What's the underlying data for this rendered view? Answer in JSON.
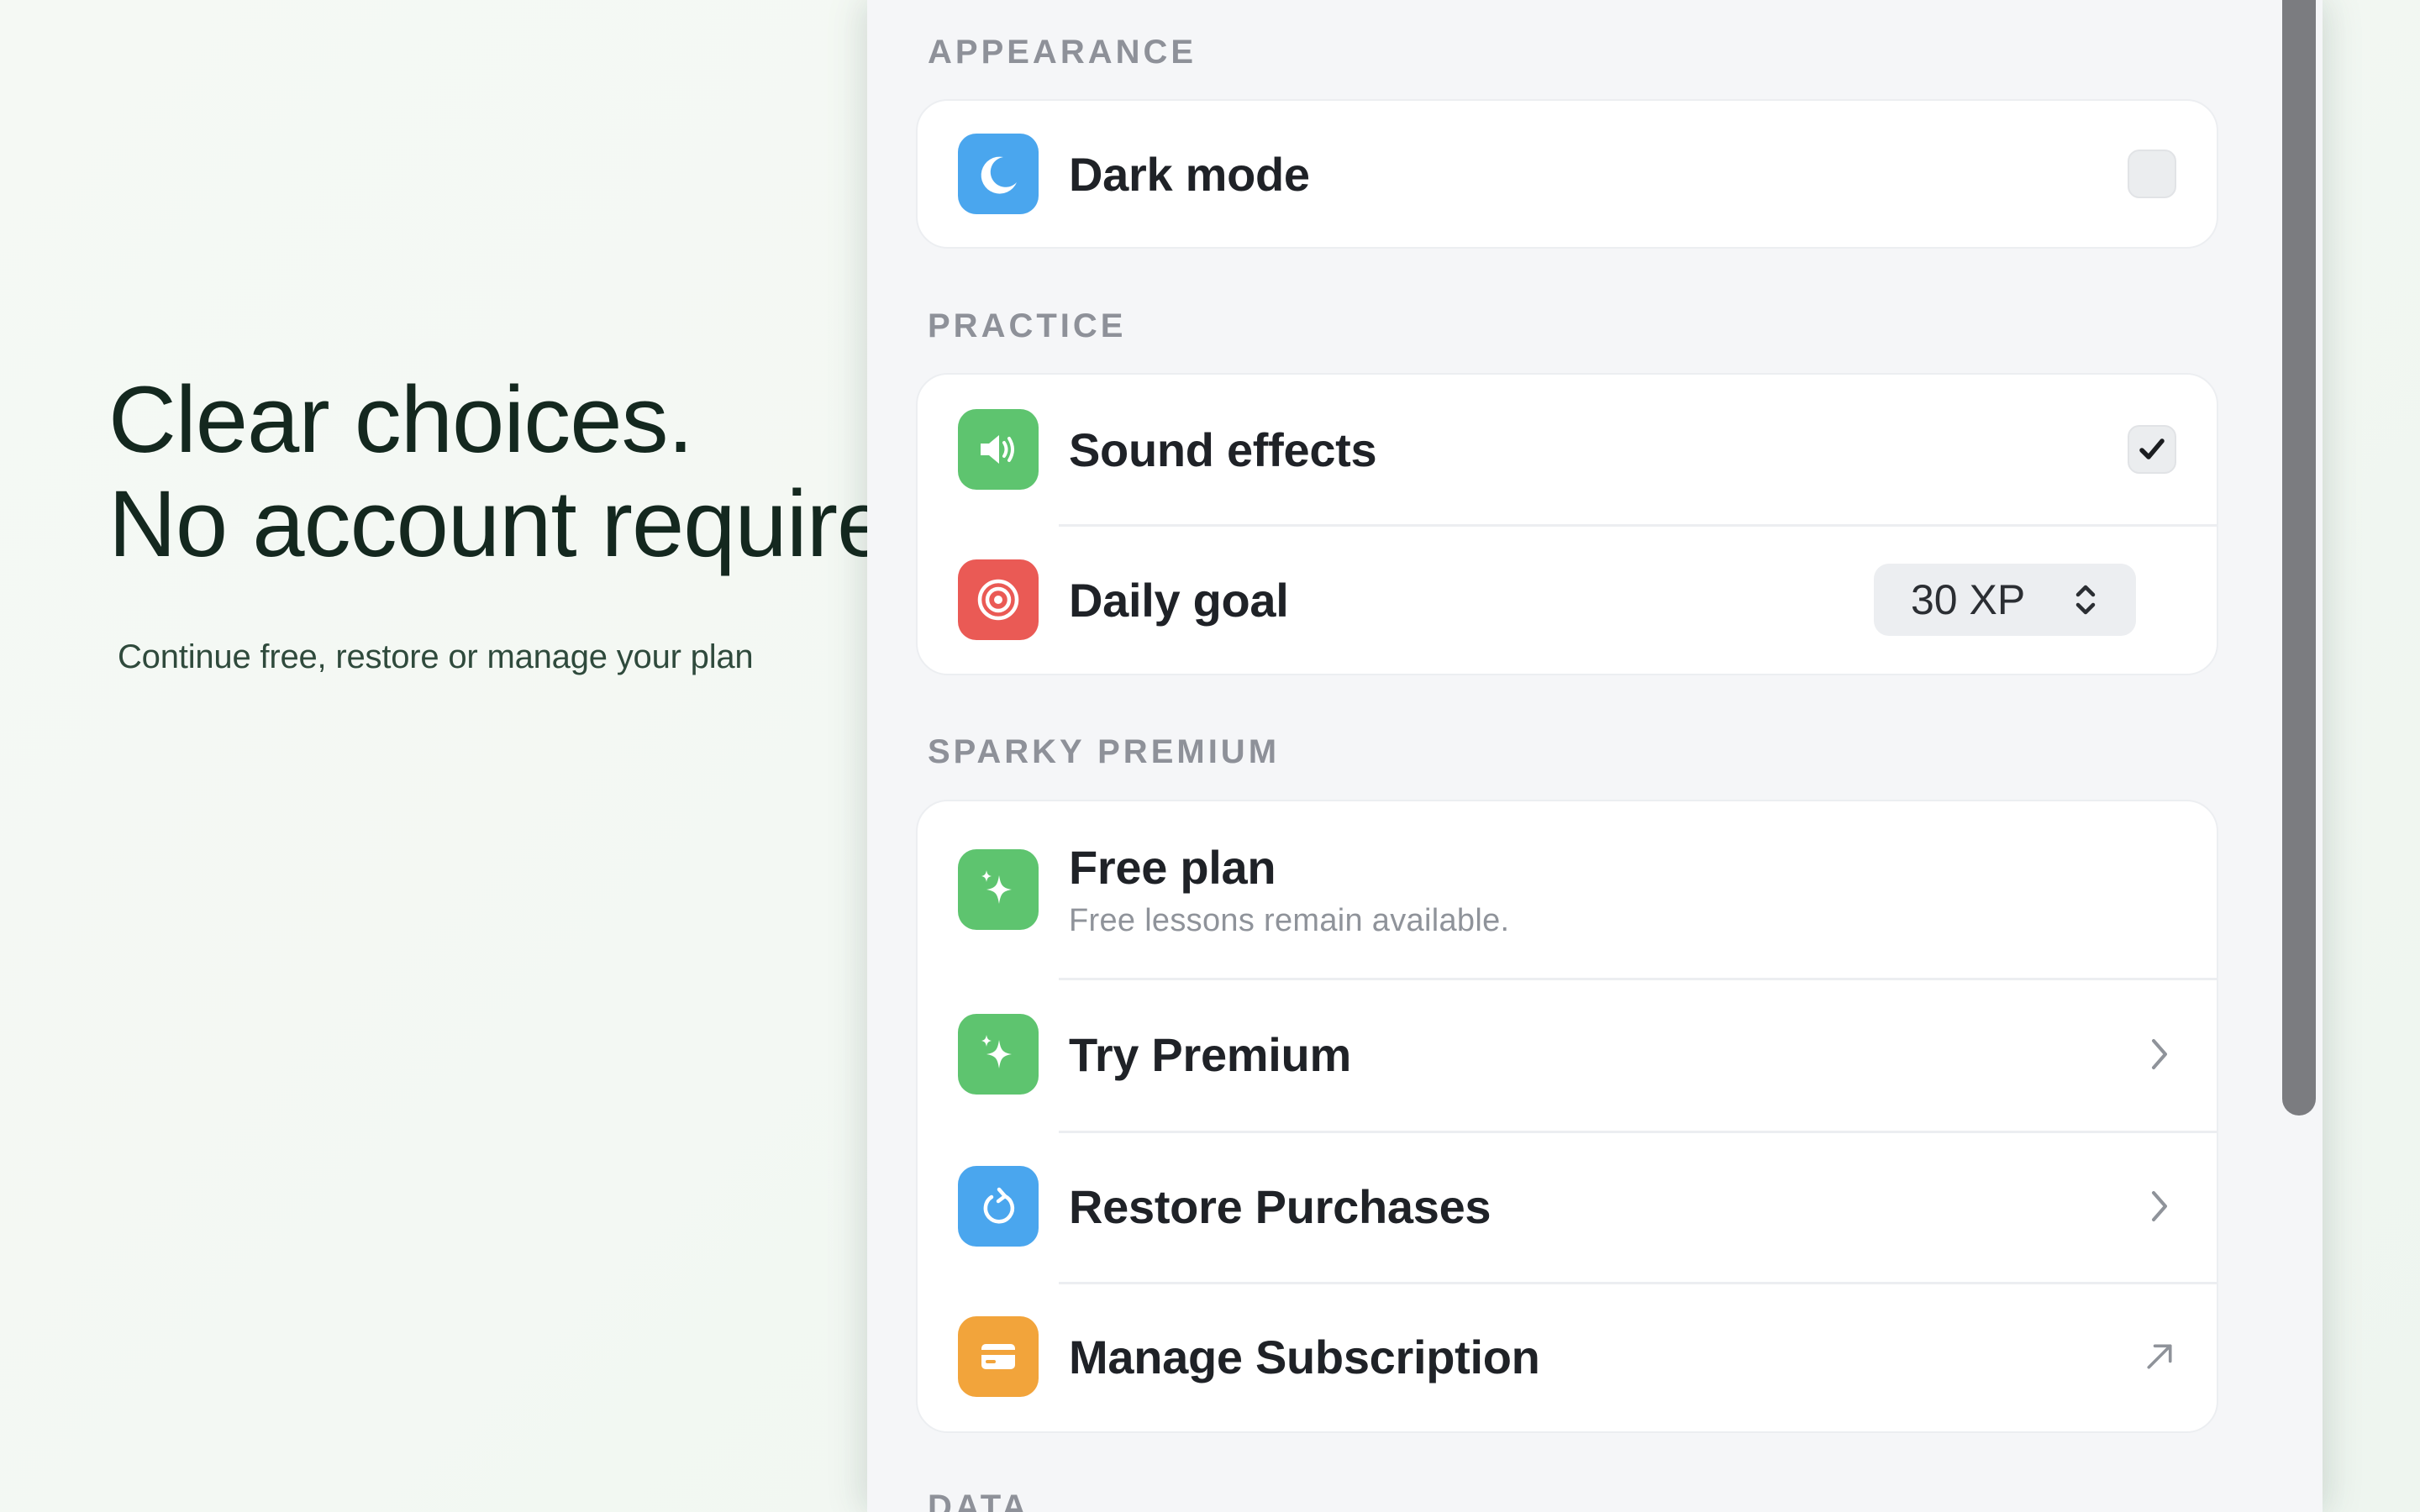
{
  "hero": {
    "title_line1": "Clear choices.",
    "title_line2": "No account required.",
    "subtitle": "Continue free, restore or manage your plan"
  },
  "settings": {
    "sections": {
      "appearance": "APPEARANCE",
      "practice": "PRACTICE",
      "premium": "SPARKY PREMIUM",
      "data": "DATA"
    },
    "appearance": {
      "dark_mode": {
        "label": "Dark mode",
        "checked": false,
        "icon": "moon-icon"
      }
    },
    "practice": {
      "sound_effects": {
        "label": "Sound effects",
        "checked": true,
        "icon": "speaker-icon"
      },
      "daily_goal": {
        "label": "Daily goal",
        "value": "30 XP",
        "icon": "target-icon"
      }
    },
    "premium": {
      "free_plan": {
        "label": "Free plan",
        "subtitle": "Free lessons remain available.",
        "icon": "sparkle-icon"
      },
      "try_premium": {
        "label": "Try Premium",
        "icon": "sparkle-icon"
      },
      "restore": {
        "label": "Restore Purchases",
        "icon": "refresh-icon"
      },
      "manage": {
        "label": "Manage Subscription",
        "icon": "card-icon"
      }
    }
  },
  "colors": {
    "blue_tile": "#4aa6ee",
    "green_tile": "#5ec46f",
    "red_tile": "#ea5a55",
    "orange_tile": "#f2a43b",
    "headline": "#14281f"
  }
}
